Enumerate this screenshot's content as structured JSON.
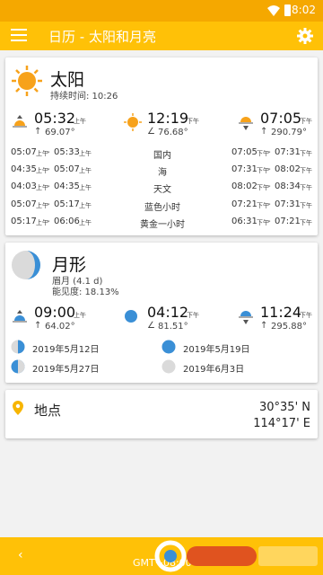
{
  "status": {
    "time": "8:02"
  },
  "appbar": {
    "title": "日历 - 太阳和月亮"
  },
  "sun": {
    "title": "太阳",
    "duration": "持续时间: 10:26",
    "rise": {
      "time": "05:32",
      "ampm": "上午",
      "azimuth": "69.07°"
    },
    "noon": {
      "time": "12:19",
      "ampm": "下午",
      "elevation": "76.68°"
    },
    "set": {
      "time": "07:05",
      "ampm": "下午",
      "azimuth": "290.79°"
    },
    "rows": [
      {
        "left1": "05:07",
        "left1_ampm": "上午",
        "left2": "05:33",
        "left2_ampm": "上午",
        "label": "国内",
        "right1": "07:05",
        "right1_ampm": "下午",
        "right2": "07:31",
        "right2_ampm": "下午"
      },
      {
        "left1": "04:35",
        "left1_ampm": "上午",
        "left2": "05:07",
        "left2_ampm": "上午",
        "label": "海",
        "right1": "07:31",
        "right1_ampm": "下午",
        "right2": "08:02",
        "right2_ampm": "下午"
      },
      {
        "left1": "04:03",
        "left1_ampm": "上午",
        "left2": "04:35",
        "left2_ampm": "上午",
        "label": "天文",
        "right1": "08:02",
        "right1_ampm": "下午",
        "right2": "08:34",
        "right2_ampm": "下午"
      },
      {
        "left1": "05:07",
        "left1_ampm": "上午",
        "left2": "05:17",
        "left2_ampm": "上午",
        "label": "蓝色小时",
        "right1": "07:21",
        "right1_ampm": "下午",
        "right2": "07:31",
        "right2_ampm": "下午"
      },
      {
        "left1": "05:17",
        "left1_ampm": "上午",
        "left2": "06:06",
        "left2_ampm": "上午",
        "label": "黄金一小时",
        "right1": "06:31",
        "right1_ampm": "下午",
        "right2": "07:21",
        "right2_ampm": "下午"
      }
    ]
  },
  "moon": {
    "title": "月形",
    "phase": "眉月 (4.1 d)",
    "visibility": "能见度: 18.13%",
    "rise": {
      "time": "09:00",
      "ampm": "上午",
      "azimuth": "64.02°"
    },
    "transit": {
      "time": "04:12",
      "ampm": "下午",
      "elevation": "81.51°"
    },
    "set": {
      "time": "11:24",
      "ampm": "下午",
      "azimuth": "295.88°"
    },
    "phases": [
      {
        "date": "2019年5月12日",
        "icon": "first-quarter-moon-icon"
      },
      {
        "date": "2019年5月19日",
        "icon": "full-moon-icon"
      },
      {
        "date": "2019年5月27日",
        "icon": "last-quarter-moon-icon"
      },
      {
        "date": "2019年6月3日",
        "icon": "new-moon-icon"
      }
    ]
  },
  "location": {
    "title": "地点",
    "lat": "30°35' N",
    "lon": "114°17' E"
  },
  "bottom": {
    "gmt": "GMT+08:00"
  },
  "colors": {
    "accent": "#ffc107",
    "status": "#f5a800",
    "sun": "#f7a21b",
    "moon": "#3a8fd6"
  }
}
